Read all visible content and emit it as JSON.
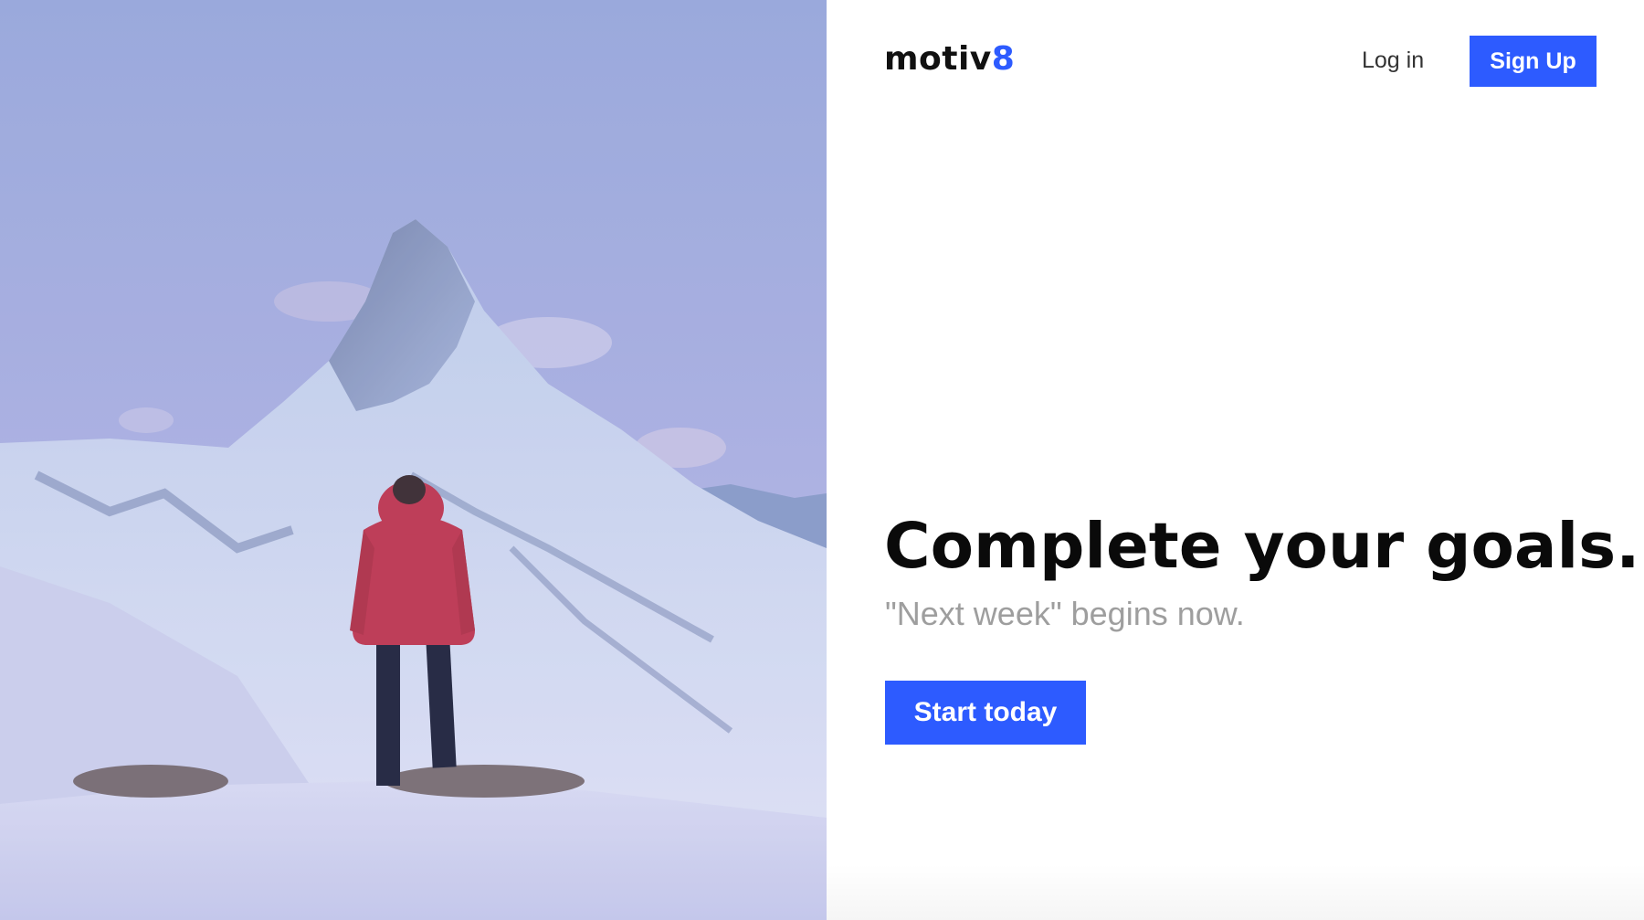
{
  "header": {
    "logo_text": "motiv",
    "logo_accent": "8",
    "login_label": "Log in",
    "signup_label": "Sign Up"
  },
  "hero": {
    "headline": "Complete your goals.",
    "tagline": "\"Next week\" begins now.",
    "cta_label": "Start today"
  },
  "colors": {
    "accent": "#2d5bff",
    "text_dark": "#0a0a0a",
    "text_muted": "#9e9e9e"
  },
  "icons": {
    "hero_image": "mountain-hiker-photo"
  }
}
